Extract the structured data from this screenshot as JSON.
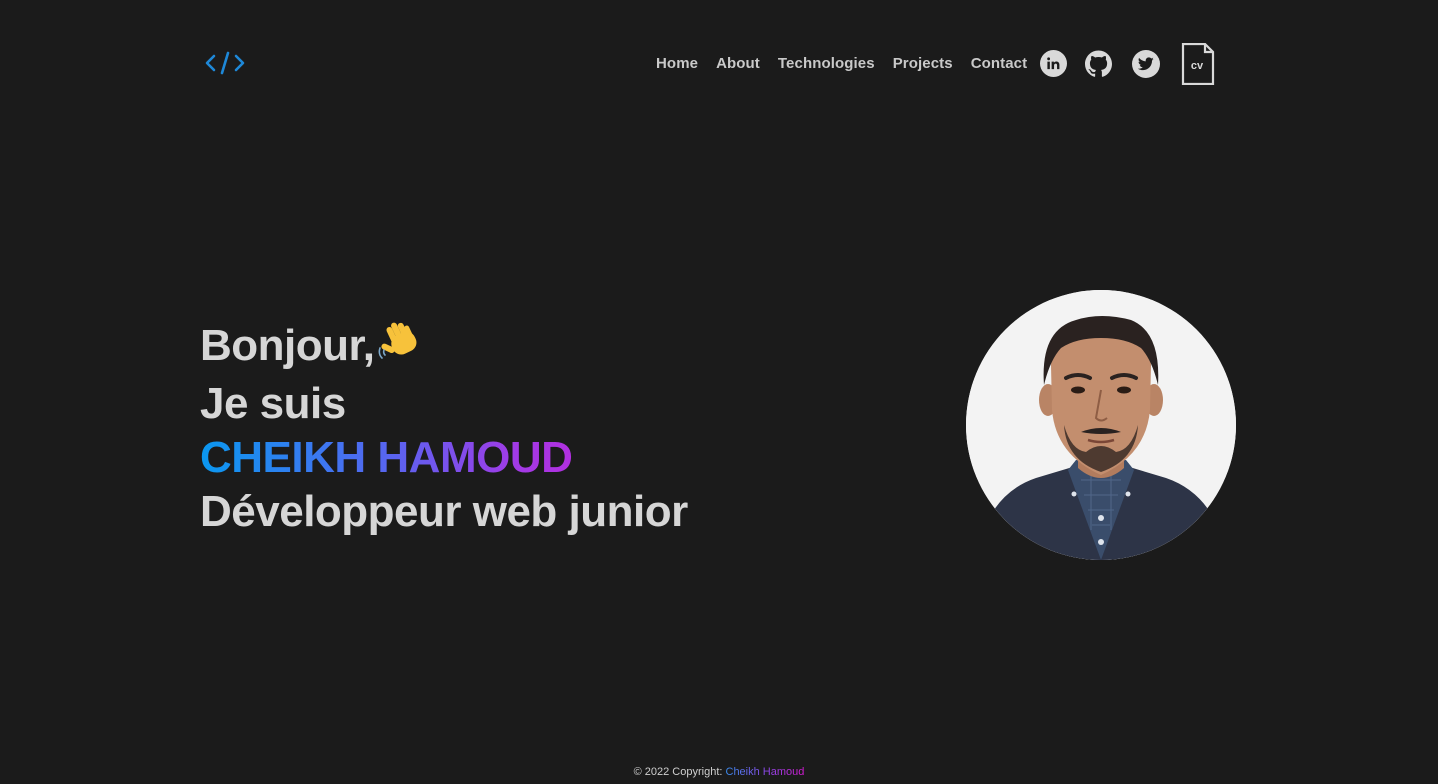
{
  "header": {
    "logo": "</>",
    "nav": [
      "Home",
      "About",
      "Technologies",
      "Projects",
      "Contact"
    ],
    "social": {
      "linkedin": "linkedin-icon",
      "github": "github-icon",
      "twitter": "twitter-icon",
      "cv_label": "cv"
    }
  },
  "hero": {
    "greeting": "Bonjour,",
    "wave_emoji": "👋",
    "intro": "Je suis",
    "name": "CHEIKH HAMOUD",
    "role": "Développeur web junior"
  },
  "footer": {
    "copyright": "© 2022 Copyright:",
    "author": "Cheikh Hamoud"
  },
  "colors": {
    "background": "#1b1b1b",
    "text": "#d6d6d6",
    "logo": "#1e88d8",
    "gradient_start": "#0a98f0",
    "gradient_end": "#d21ad1"
  }
}
